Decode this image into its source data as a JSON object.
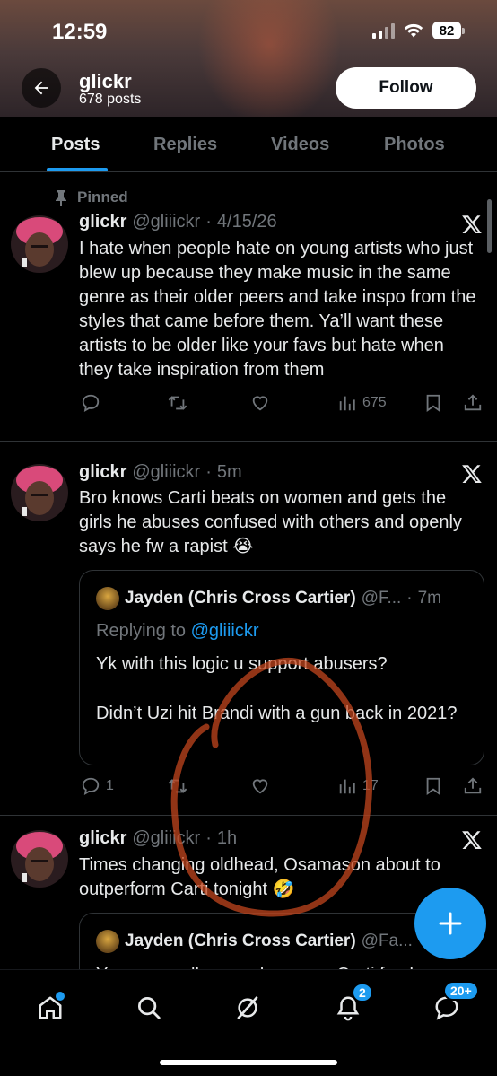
{
  "status_bar": {
    "time": "12:59",
    "battery": "82"
  },
  "profile": {
    "name": "glickr",
    "post_count": "678 posts",
    "follow_label": "Follow"
  },
  "tabs": [
    {
      "label": "Posts",
      "active": true
    },
    {
      "label": "Replies",
      "active": false
    },
    {
      "label": "Videos",
      "active": false
    },
    {
      "label": "Photos",
      "active": false
    }
  ],
  "posts": [
    {
      "pinned_label": "Pinned",
      "name": "glickr",
      "handle": "@gliiickr",
      "sep": "·",
      "time": "4/15/26",
      "text": "I hate when people hate on young artists who just blew up because they make music in the same genre as their older peers and take inspo from the styles that came before them. Ya’ll want these artists to be older like your favs but hate when they take inspiration from them",
      "views": "675"
    },
    {
      "name": "glickr",
      "handle": "@gliiickr",
      "sep": "·",
      "time": "5m",
      "text": "Bro knows Carti beats on women and gets the girls he abuses confused with others and openly says he fw a rapist 😭",
      "quote": {
        "name": "Jayden (Chris Cross Cartier)",
        "handle": "@F...",
        "sep": "·",
        "time": "7m",
        "replying_prefix": "Replying to",
        "replying_to": "@gliiickr",
        "text_1": "Yk with this logic u support abusers?",
        "text_2": "Didn’t Uzi hit Brandi with a gun back in 2021?"
      },
      "replies": "1",
      "views": "17"
    },
    {
      "name": "glickr",
      "handle": "@gliiickr",
      "sep": "·",
      "time": "1h",
      "text": "Times changing oldhead, Osamason about to outperform Carti tonight 🤣",
      "quote": {
        "name": "Jayden (Chris Cross Cartier)",
        "handle": "@Fa...",
        "text_partial": "You can really see who was a Carti fan by"
      }
    }
  ],
  "bottom_nav": {
    "notifications_badge": "2",
    "messages_badge": "20+"
  },
  "colors": {
    "accent": "#1d9bf0",
    "text": "#e7e9ea",
    "muted": "#71767b",
    "divider": "#2f3336",
    "watermark": "#c2461e"
  },
  "icons": [
    "back-arrow-icon",
    "pin-icon",
    "x-logo-icon",
    "reply-icon",
    "repost-icon",
    "like-icon",
    "views-icon",
    "bookmark-icon",
    "share-icon",
    "compose-plus-icon",
    "home-icon",
    "search-icon",
    "grok-icon",
    "bell-icon",
    "messages-icon"
  ]
}
